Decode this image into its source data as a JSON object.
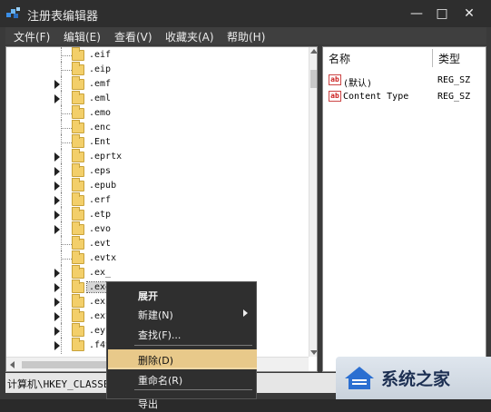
{
  "window": {
    "title": "注册表编辑器",
    "controls": {
      "minimize": "—",
      "maximize": "□",
      "close": "✕"
    }
  },
  "menubar": {
    "items": [
      "文件(F)",
      "编辑(E)",
      "查看(V)",
      "收藏夹(A)",
      "帮助(H)"
    ]
  },
  "tree": {
    "items": [
      {
        "label": ".eif",
        "expandable": false
      },
      {
        "label": ".eip",
        "expandable": false
      },
      {
        "label": ".emf",
        "expandable": true
      },
      {
        "label": ".eml",
        "expandable": true
      },
      {
        "label": ".emo",
        "expandable": false
      },
      {
        "label": ".enc",
        "expandable": false
      },
      {
        "label": ".Ent",
        "expandable": false
      },
      {
        "label": ".eprtx",
        "expandable": true
      },
      {
        "label": ".eps",
        "expandable": true
      },
      {
        "label": ".epub",
        "expandable": true
      },
      {
        "label": ".erf",
        "expandable": true
      },
      {
        "label": ".etp",
        "expandable": true
      },
      {
        "label": ".evo",
        "expandable": true
      },
      {
        "label": ".evt",
        "expandable": false
      },
      {
        "label": ".evtx",
        "expandable": false
      },
      {
        "label": ".ex_",
        "expandable": true
      },
      {
        "label": ".exe",
        "expandable": true,
        "selected": true
      },
      {
        "label": ".exp",
        "expandable": true
      },
      {
        "label": ".ext",
        "expandable": true
      },
      {
        "label": ".eyb",
        "expandable": true
      },
      {
        "label": ".f4v",
        "expandable": true
      }
    ]
  },
  "values": {
    "header": {
      "name": "名称",
      "type": "类型"
    },
    "rows": [
      {
        "icon": "ab",
        "name": "(默认)",
        "type": "REG_SZ"
      },
      {
        "icon": "ab",
        "name": "Content Type",
        "type": "REG_SZ"
      }
    ]
  },
  "statusbar": {
    "path": "计算机\\HKEY_CLASSES_ROOT\\.exe"
  },
  "context_menu": {
    "items": [
      {
        "label": "展开",
        "bold": true
      },
      {
        "label": "新建(N)",
        "submenu": true
      },
      {
        "label": "查找(F)..."
      },
      {
        "label": "删除(D)",
        "highlighted": true
      },
      {
        "label": "重命名(R)"
      },
      {
        "label": "导出"
      }
    ]
  },
  "watermark": {
    "text": "系统之家"
  },
  "colors": {
    "accent_highlight": "#e8c98a",
    "title_bg": "#2e2e2e",
    "folder": "#f3cf6a"
  }
}
